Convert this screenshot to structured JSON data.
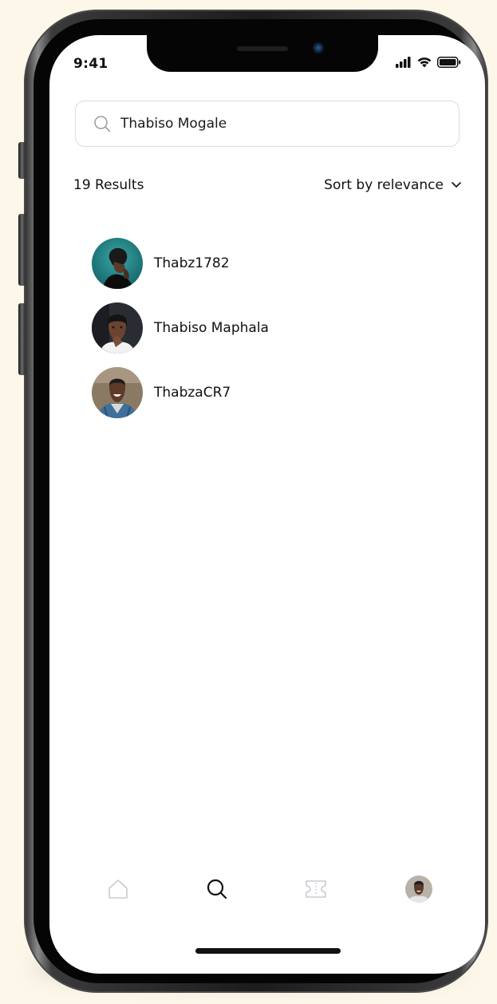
{
  "status_bar": {
    "time": "9:41"
  },
  "search": {
    "value": "Thabiso Mogale",
    "icon": "search-icon"
  },
  "results": {
    "count_label": "19 Results",
    "sort_label": "Sort by relevance",
    "items": [
      {
        "name": "Thabz1782",
        "avatar": "avatar-teal"
      },
      {
        "name": "Thabiso Maphala",
        "avatar": "avatar-dark"
      },
      {
        "name": "ThabzaCR7",
        "avatar": "avatar-denim"
      }
    ]
  },
  "nav": {
    "items": [
      {
        "icon": "home-icon",
        "active": false
      },
      {
        "icon": "search-icon",
        "active": true
      },
      {
        "icon": "ticket-icon",
        "active": false
      },
      {
        "icon": "profile-avatar",
        "active": false
      }
    ]
  },
  "colors": {
    "background": "#fdf7ea",
    "text": "#111111",
    "inactive_icon": "#c8ccd2",
    "border": "#dcdcdc"
  }
}
